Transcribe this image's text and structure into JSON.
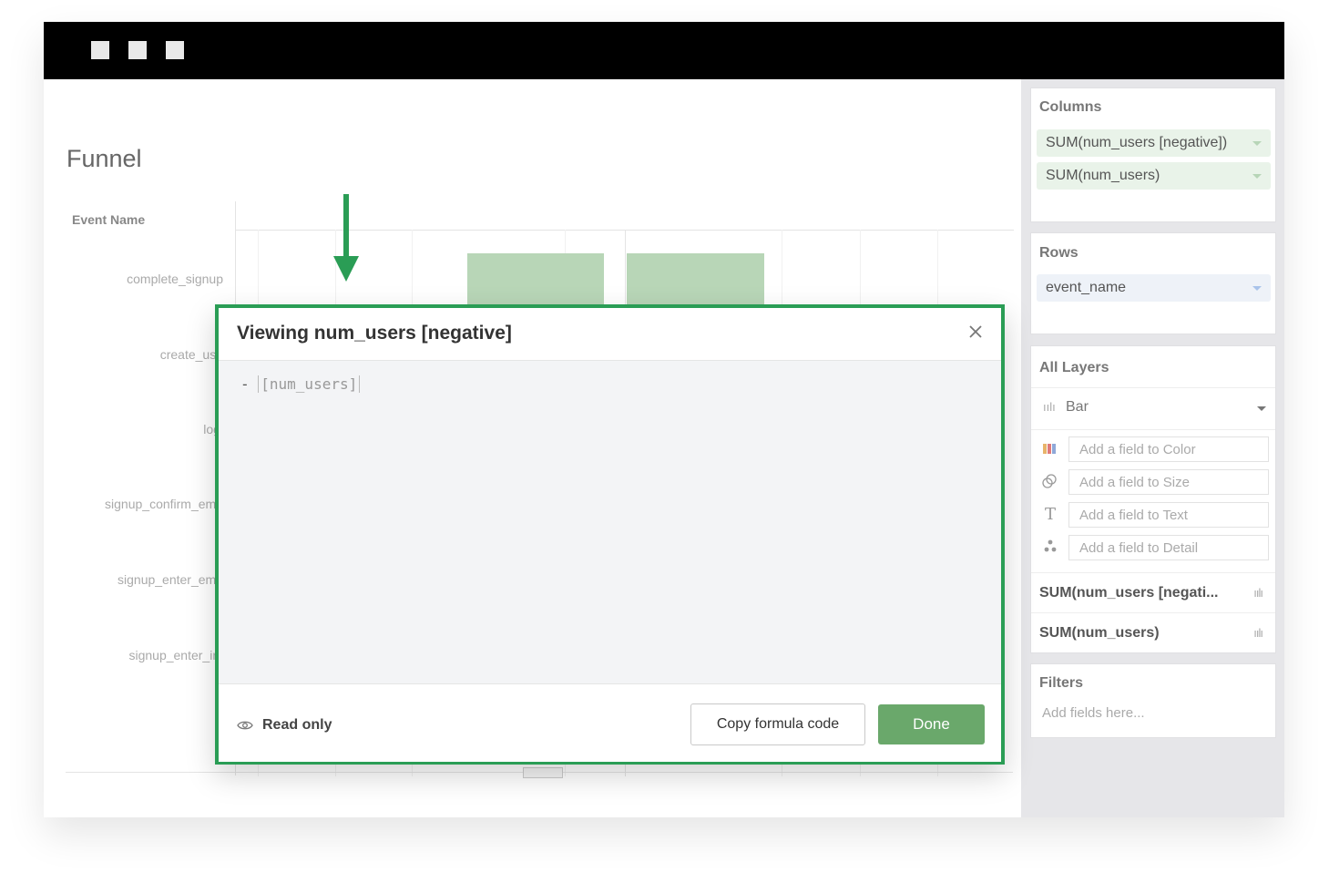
{
  "main": {
    "title": "Funnel",
    "event_header": "Event Name",
    "events": [
      "complete_signup",
      "create_use",
      "logi",
      "signup_confirm_ema",
      "signup_enter_ema",
      "signup_enter_inf"
    ]
  },
  "side": {
    "columns": {
      "title": "Columns",
      "pills": [
        "SUM(num_users [negative])",
        "SUM(num_users)"
      ]
    },
    "rows": {
      "title": "Rows",
      "pills": [
        "event_name"
      ]
    },
    "layers": {
      "title": "All Layers",
      "mark_type": "Bar",
      "fields": [
        {
          "icon": "color-icon",
          "placeholder": "Add a field to Color"
        },
        {
          "icon": "size-icon",
          "placeholder": "Add a field to Size"
        },
        {
          "icon": "text-icon",
          "placeholder": "Add a field to Text"
        },
        {
          "icon": "detail-icon",
          "placeholder": "Add a field to Detail"
        }
      ],
      "measures": [
        "SUM(num_users [negati...",
        "SUM(num_users)"
      ]
    },
    "filters": {
      "title": "Filters",
      "placeholder": "Add fields here..."
    }
  },
  "modal": {
    "title": "Viewing num_users [negative]",
    "code_prefix": "- ",
    "code_field": "[num_users]",
    "readonly_label": "Read only",
    "copy_label": "Copy formula code",
    "done_label": "Done"
  },
  "colors": {
    "accent": "#2a9d55",
    "done": "#6aa86b",
    "bar": "#b8d6b7"
  }
}
